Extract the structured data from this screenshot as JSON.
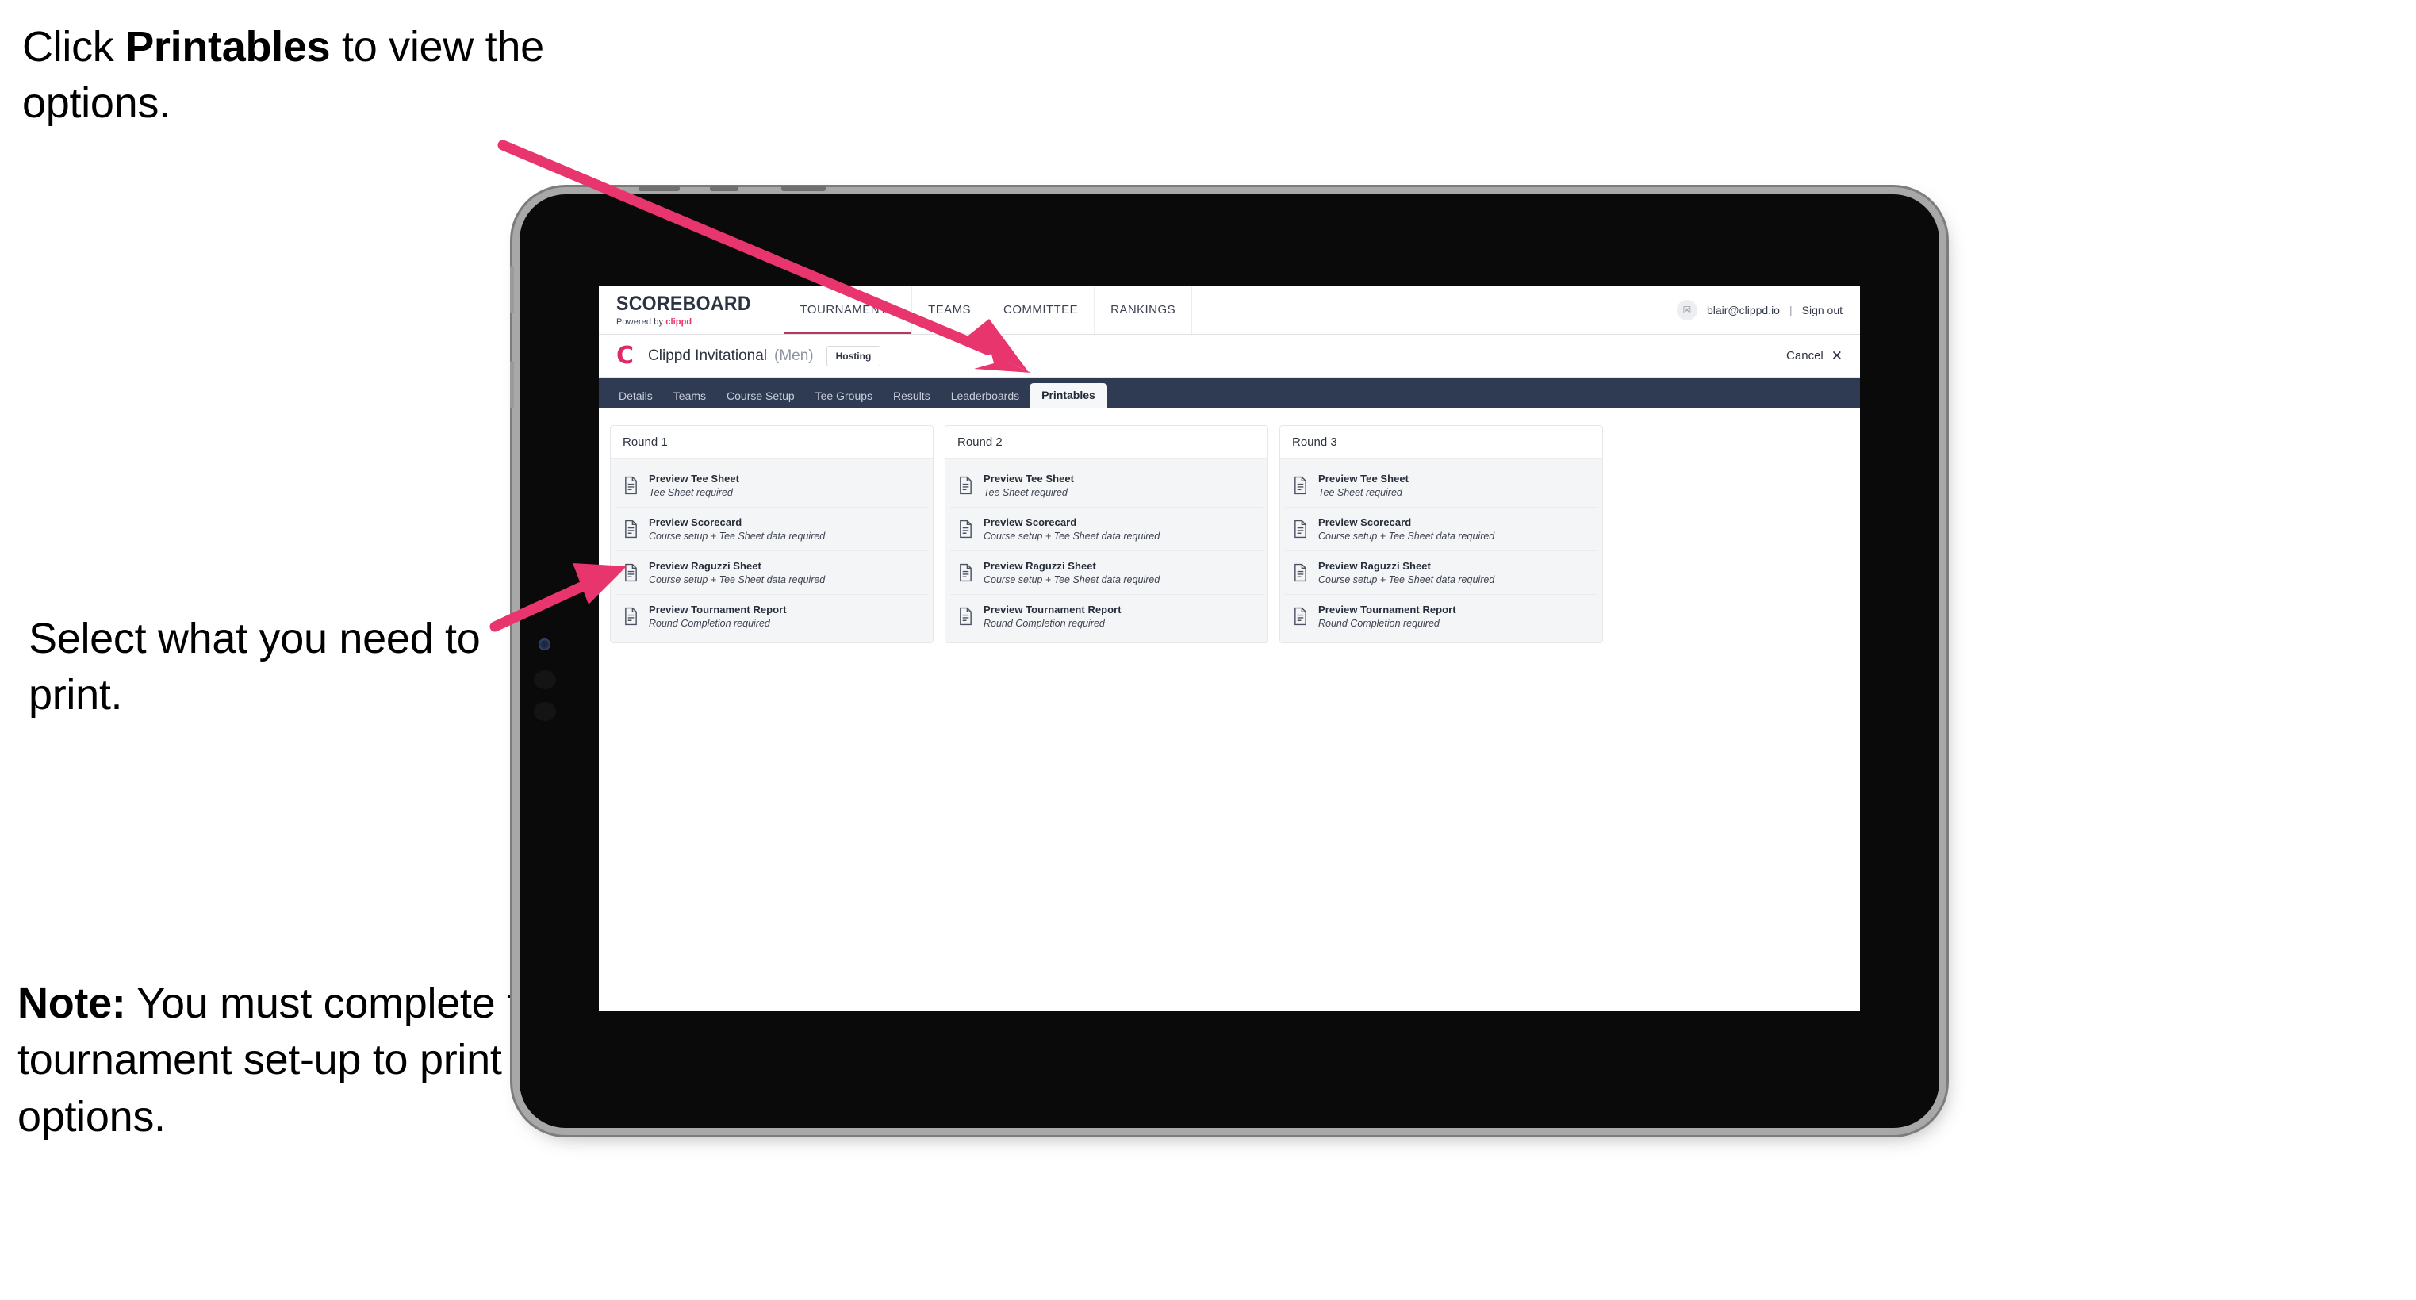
{
  "annotations": {
    "click_printables": {
      "prefix": "Click ",
      "bold": "Printables",
      "suffix": " to view the options."
    },
    "select_print": {
      "text": "Select what you need to print."
    },
    "note": {
      "bold": "Note:",
      "text": " You must complete the tournament set-up to print all the options."
    }
  },
  "colors": {
    "accent_pink": "#E8356D",
    "brand_red": "#E02A63",
    "tabstrip_navy": "#2F3B52",
    "body_dark": "#262D3A"
  },
  "browser": {
    "topbar": {
      "brand_title": "SCOREBOARD",
      "brand_sub_prefix": "Powered by ",
      "brand_sub_name": "clippd",
      "nav_items": [
        {
          "label": "TOURNAMENTS",
          "active": true
        },
        {
          "label": "TEAMS",
          "active": false
        },
        {
          "label": "COMMITTEE",
          "active": false
        },
        {
          "label": "RANKINGS",
          "active": false
        }
      ],
      "avatar_glyph": "☒",
      "user_email": "blair@clippd.io",
      "separator": "|",
      "sign_out": "Sign out"
    },
    "tournament_bar": {
      "logo_mark": "C",
      "name": "Clippd Invitational",
      "gender": "(Men)",
      "hosting_chip": "Hosting",
      "cancel_label": "Cancel",
      "cancel_icon": "✕"
    },
    "tabs": [
      {
        "label": "Details",
        "active": false
      },
      {
        "label": "Teams",
        "active": false
      },
      {
        "label": "Course Setup",
        "active": false
      },
      {
        "label": "Tee Groups",
        "active": false
      },
      {
        "label": "Results",
        "active": false
      },
      {
        "label": "Leaderboards",
        "active": false
      },
      {
        "label": "Printables",
        "active": true
      }
    ],
    "printables": {
      "rounds": [
        {
          "heading": "Round 1",
          "items": [
            {
              "title": "Preview Tee Sheet",
              "sub": "Tee Sheet required"
            },
            {
              "title": "Preview Scorecard",
              "sub": "Course setup + Tee Sheet data required"
            },
            {
              "title": "Preview Raguzzi Sheet",
              "sub": "Course setup + Tee Sheet data required"
            },
            {
              "title": "Preview Tournament Report",
              "sub": "Round Completion required"
            }
          ]
        },
        {
          "heading": "Round 2",
          "items": [
            {
              "title": "Preview Tee Sheet",
              "sub": "Tee Sheet required"
            },
            {
              "title": "Preview Scorecard",
              "sub": "Course setup + Tee Sheet data required"
            },
            {
              "title": "Preview Raguzzi Sheet",
              "sub": "Course setup + Tee Sheet data required"
            },
            {
              "title": "Preview Tournament Report",
              "sub": "Round Completion required"
            }
          ]
        },
        {
          "heading": "Round 3",
          "items": [
            {
              "title": "Preview Tee Sheet",
              "sub": "Tee Sheet required"
            },
            {
              "title": "Preview Scorecard",
              "sub": "Course setup + Tee Sheet data required"
            },
            {
              "title": "Preview Raguzzi Sheet",
              "sub": "Course setup + Tee Sheet data required"
            },
            {
              "title": "Preview Tournament Report",
              "sub": "Round Completion required"
            }
          ]
        }
      ]
    }
  }
}
